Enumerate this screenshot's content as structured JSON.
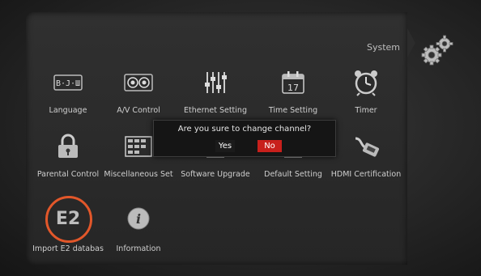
{
  "header": {
    "title": "System"
  },
  "menu": {
    "row1": [
      {
        "label": "Language",
        "icon": "language-icon",
        "glyph": "B·J·Ш"
      },
      {
        "label": "A/V Control",
        "icon": "av-control-icon"
      },
      {
        "label": "Ethernet Setting",
        "icon": "equalizer-icon"
      },
      {
        "label": "Time Setting",
        "icon": "calendar-icon",
        "glyph": "17"
      },
      {
        "label": "Timer",
        "icon": "alarm-clock-icon"
      }
    ],
    "row2": [
      {
        "label": "Parental Control",
        "icon": "lock-icon"
      },
      {
        "label": "Miscellaneous Set",
        "icon": "grid-icon"
      },
      {
        "label": "Software Upgrade",
        "icon": "upgrade-icon"
      },
      {
        "label": "Default Setting",
        "icon": "default-icon"
      },
      {
        "label": "HDMI Certification",
        "icon": "hdmi-cable-icon"
      }
    ],
    "row3": [
      {
        "label": "Import E2 databas",
        "icon": "e2-icon",
        "glyph": "E2",
        "selected": true
      },
      {
        "label": "Information",
        "icon": "info-icon",
        "glyph": "i"
      }
    ]
  },
  "dialog": {
    "message": "Are you sure to change channel?",
    "yes_label": "Yes",
    "no_label": "No"
  },
  "colors": {
    "accent": "#e2572a",
    "no_button": "#c8201c"
  }
}
